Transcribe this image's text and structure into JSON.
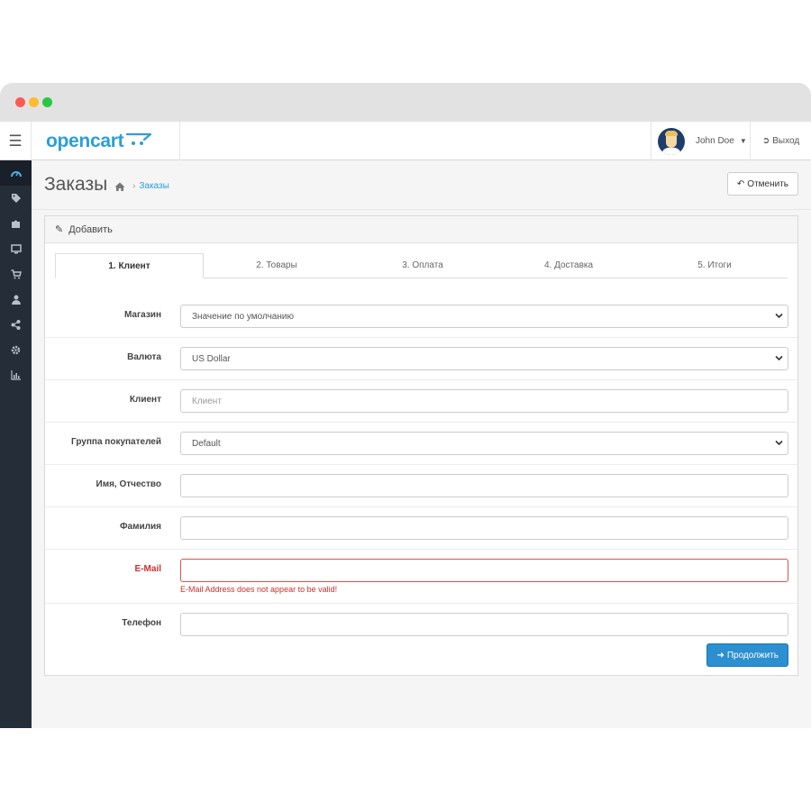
{
  "header": {
    "logo_text": "opencart",
    "user_name": "John Doe",
    "logout_label": "Выход"
  },
  "page": {
    "title": "Заказы",
    "breadcrumb": [
      "Заказы"
    ],
    "cancel_label": "Отменить"
  },
  "panel": {
    "heading": "Добавить"
  },
  "tabs": [
    {
      "label": "1. Клиент",
      "active": true
    },
    {
      "label": "2. Товары",
      "active": false
    },
    {
      "label": "3. Оплата",
      "active": false
    },
    {
      "label": "4. Доставка",
      "active": false
    },
    {
      "label": "5. Итоги",
      "active": false
    }
  ],
  "form": {
    "store": {
      "label": "Магазин",
      "value": "Значение по умолчанию"
    },
    "currency": {
      "label": "Валюта",
      "value": "US Dollar"
    },
    "customer": {
      "label": "Клиент",
      "value": "",
      "placeholder": "Клиент"
    },
    "customer_group": {
      "label": "Группа покупателей",
      "value": "Default"
    },
    "firstname": {
      "label": "Имя, Отчество",
      "value": ""
    },
    "lastname": {
      "label": "Фамилия",
      "value": ""
    },
    "email": {
      "label": "E-Mail",
      "value": "",
      "error": "E-Mail Address does not appear to be valid!"
    },
    "telephone": {
      "label": "Телефон",
      "value": ""
    }
  },
  "continue_label": "Продолжить",
  "sidebar_icons": [
    "dashboard-icon",
    "tag-icon",
    "puzzle-icon",
    "desktop-icon",
    "cart-icon",
    "user-icon",
    "share-icon",
    "cog-icon",
    "bar-chart-icon"
  ],
  "colors": {
    "brand": "#2b9ed8",
    "sidebar": "#252d38",
    "error": "#c9302c",
    "primary_button": "#2b8fd0"
  }
}
